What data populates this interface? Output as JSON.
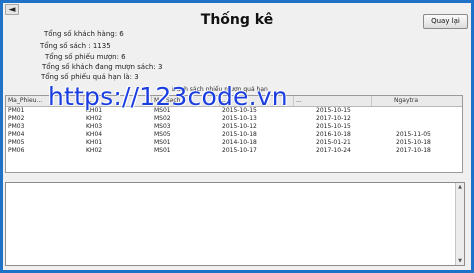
{
  "window": {
    "back_glyph": "◄",
    "title": "Thống kê",
    "return_button": "Quay lại"
  },
  "stats": {
    "customers": "Tổng số khách hàng: 6",
    "books": "Tổng số sách : 1135",
    "loans": "Tổng số phiếu mượn: 6",
    "borrowing": "Tổng số khách đang mượn sách: 3",
    "overdue": "Tổng số phiếu quá hạn là: 3"
  },
  "overdue_caption": "Danh sách phiếu mượn quá hạn",
  "watermark": "https://123code.vn",
  "table": {
    "columns": [
      "Ma_Phieu...",
      "...",
      "Ma_Sach",
      "...",
      "...",
      "Ngaytra"
    ],
    "rows": [
      [
        "PM01",
        "KH01",
        "MS01",
        "2015-10-15",
        "2015-10-15",
        ""
      ],
      [
        "PM02",
        "KH02",
        "MS02",
        "2015-10-13",
        "2017-10-12",
        ""
      ],
      [
        "PM03",
        "KH03",
        "MS03",
        "2015-10-12",
        "2015-10-15",
        ""
      ],
      [
        "PM04",
        "KH04",
        "MS05",
        "2015-10-18",
        "2016-10-18",
        "2015-11-05"
      ],
      [
        "PM05",
        "KH01",
        "MS01",
        "2014-10-18",
        "2015-01-21",
        "2015-10-18"
      ],
      [
        "PM06",
        "KH02",
        "MS01",
        "2015-10-17",
        "2017-10-24",
        "2017-10-18"
      ]
    ]
  },
  "scroll": {
    "up": "▲",
    "down": "▼"
  },
  "colors": {
    "border_accent": "#1e73c8",
    "watermark": "#1a3de0"
  }
}
